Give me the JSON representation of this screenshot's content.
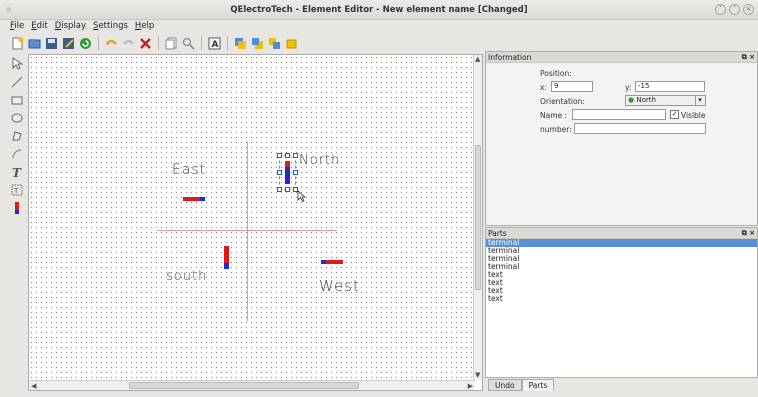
{
  "window": {
    "title": "QElectroTech - Element Editor - New element name [Changed]",
    "controls": [
      "˅",
      "˄",
      "×"
    ]
  },
  "menu": {
    "file": "File",
    "edit": "Edit",
    "display": "Display",
    "settings": "Settings",
    "help": "Help"
  },
  "toolbar": {
    "icons": [
      "new-icon",
      "open-icon",
      "save-icon",
      "save-as-icon",
      "reload-icon",
      "undo-icon",
      "redo-icon",
      "delete-icon",
      "copy-icon",
      "zoom-icon",
      "text-icon",
      "bring-front-icon",
      "raise-icon",
      "lower-icon",
      "send-back-icon"
    ]
  },
  "canvas": {
    "labels": {
      "east": "East",
      "north": "North",
      "south": "south",
      "west": "West"
    },
    "colors": {
      "terminal_red": "#e01818",
      "terminal_blue": "#1a2cd8",
      "axis": "#e89a9a"
    }
  },
  "information": {
    "title": "Information",
    "position_label": "Position:",
    "x_label": "x:",
    "x_value": "9",
    "y_label": "y:",
    "y_value": "-15",
    "orientation_label": "Orientation:",
    "orientation_value": "North",
    "name_label": "Name :",
    "name_value": "",
    "visible_label": "Visible",
    "visible_checked": true,
    "number_label": "number:",
    "number_value": ""
  },
  "parts": {
    "title": "Parts",
    "items": [
      "terminal",
      "terminal",
      "terminal",
      "terminal",
      "text",
      "text",
      "text",
      "text"
    ]
  },
  "tabs": {
    "undo": "Undo",
    "parts": "Parts"
  }
}
